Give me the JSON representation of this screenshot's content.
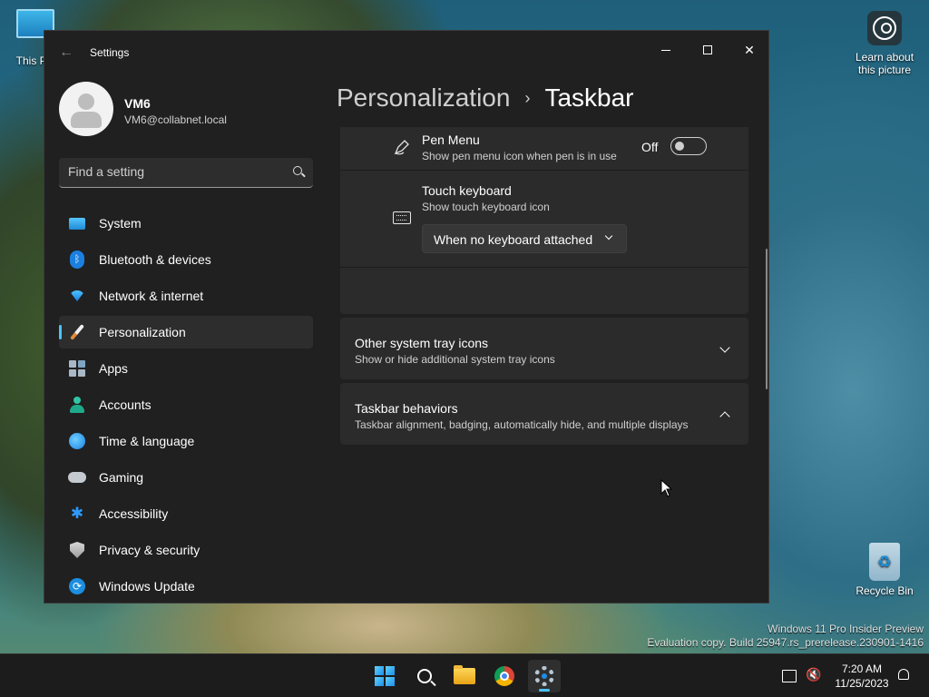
{
  "desktop": {
    "this_pc_label": "This PC",
    "learn_label": "Learn about this picture",
    "recycle_label": "Recycle Bin",
    "watermark_line1": "Windows 11 Pro Insider Preview",
    "watermark_line2": "Evaluation copy. Build 25947.rs_prerelease.230901-1416"
  },
  "window": {
    "title": "Settings",
    "minimize_icon": "minimize-icon",
    "maximize_icon": "maximize-icon",
    "close_icon": "close-icon"
  },
  "profile": {
    "name": "VM6",
    "email": "VM6@collabnet.local"
  },
  "search": {
    "placeholder": "Find a setting"
  },
  "sidebar": {
    "items": [
      {
        "label": "System",
        "icon": "system-icon"
      },
      {
        "label": "Bluetooth & devices",
        "icon": "bluetooth-icon"
      },
      {
        "label": "Network & internet",
        "icon": "network-icon"
      },
      {
        "label": "Personalization",
        "icon": "brush-icon",
        "active": true
      },
      {
        "label": "Apps",
        "icon": "apps-icon"
      },
      {
        "label": "Accounts",
        "icon": "accounts-icon"
      },
      {
        "label": "Time & language",
        "icon": "globe-icon"
      },
      {
        "label": "Gaming",
        "icon": "gamepad-icon"
      },
      {
        "label": "Accessibility",
        "icon": "accessibility-icon"
      },
      {
        "label": "Privacy & security",
        "icon": "shield-icon"
      },
      {
        "label": "Windows Update",
        "icon": "update-icon"
      }
    ]
  },
  "breadcrumb": {
    "parent": "Personalization",
    "separator": "›",
    "current": "Taskbar"
  },
  "settings": {
    "pen_menu": {
      "title": "Pen Menu",
      "subtitle": "Show pen menu icon when pen is in use",
      "toggle_label": "Off",
      "toggle_on": false
    },
    "touch_keyboard": {
      "title": "Touch keyboard",
      "subtitle": "Show touch keyboard icon",
      "dropdown_value": "When no keyboard attached"
    },
    "other_tray": {
      "title": "Other system tray icons",
      "subtitle": "Show or hide additional system tray icons",
      "expanded": false
    },
    "behaviors": {
      "title": "Taskbar behaviors",
      "subtitle": "Taskbar alignment, badging, automatically hide, and multiple displays",
      "expanded": true
    }
  },
  "taskbar": {
    "apps": [
      "start-icon",
      "search-icon",
      "file-explorer-icon",
      "chrome-icon",
      "settings-icon"
    ],
    "time": "7:20 AM",
    "date": "11/25/2023"
  },
  "colors": {
    "accent": "#4cc2ff",
    "window_bg": "#202020",
    "card_bg": "#2b2b2b"
  }
}
